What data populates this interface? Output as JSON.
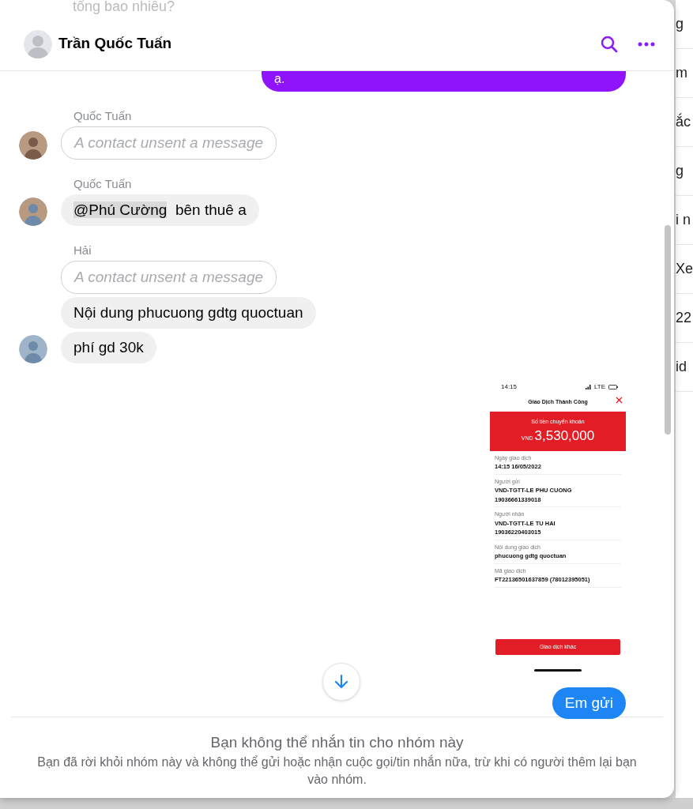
{
  "background": {
    "top_text": "tổng bao nhiêu?",
    "side_texts": [
      "g",
      "m",
      "ắc",
      "g",
      "i n",
      "Xe",
      "22",
      "id"
    ]
  },
  "header": {
    "title": "Trần Quốc Tuấn"
  },
  "messages": [
    {
      "kind": "own",
      "text": "ạ.",
      "color": "#8f14fb",
      "cut": true
    },
    {
      "kind": "unsent",
      "sender": "Quốc Tuấn",
      "text": "A contact unsent a message",
      "avatar": true
    },
    {
      "kind": "text",
      "sender": "Quốc Tuấn",
      "mention": "@Phú Cường",
      "text": "bên thuê a",
      "avatar": true
    },
    {
      "kind": "unsent",
      "sender": "Hải",
      "text": "A contact unsent a message",
      "avatar": false
    },
    {
      "kind": "text",
      "text": "Nội dung phucuong gdtg quoctuan",
      "avatar": false
    },
    {
      "kind": "text",
      "text": "phí gd 30k",
      "avatar": true
    },
    {
      "kind": "receipt",
      "time": "14:15",
      "network": "LTE",
      "title": "Giao Dịch Thành Công",
      "amount_label": "Số tiền chuyển khoản",
      "currency": "VND",
      "amount": "3,530,000",
      "fields": [
        {
          "label": "Ngày giao dịch",
          "lines": [
            "14:15 16/05/2022"
          ]
        },
        {
          "label": "Người gửi",
          "lines": [
            "VND-TGTT-LE PHU CUONG",
            "19036661339018"
          ]
        },
        {
          "label": "Người nhận",
          "lines": [
            "VND-TGTT-LE TU HAI",
            "19036220403015"
          ]
        },
        {
          "label": "Nội dung giao dịch",
          "lines": [
            "phucuong gdtg quoctuan"
          ]
        },
        {
          "label": "Mã giao dịch",
          "lines": [
            "FT22136501637859 (78012395051)"
          ]
        }
      ],
      "button": "Giao dịch khác"
    },
    {
      "kind": "own",
      "text": "Em gửi",
      "color": "#1e86f4",
      "cut": false
    }
  ],
  "footer": {
    "title": "Bạn không thể nhắn tin cho nhóm này",
    "text": "Bạn đã rời khỏi nhóm này và không thể gửi hoặc nhận cuộc gọi/tin nhắn nữa, trừ khi có người thêm lại bạn vào nhóm."
  }
}
